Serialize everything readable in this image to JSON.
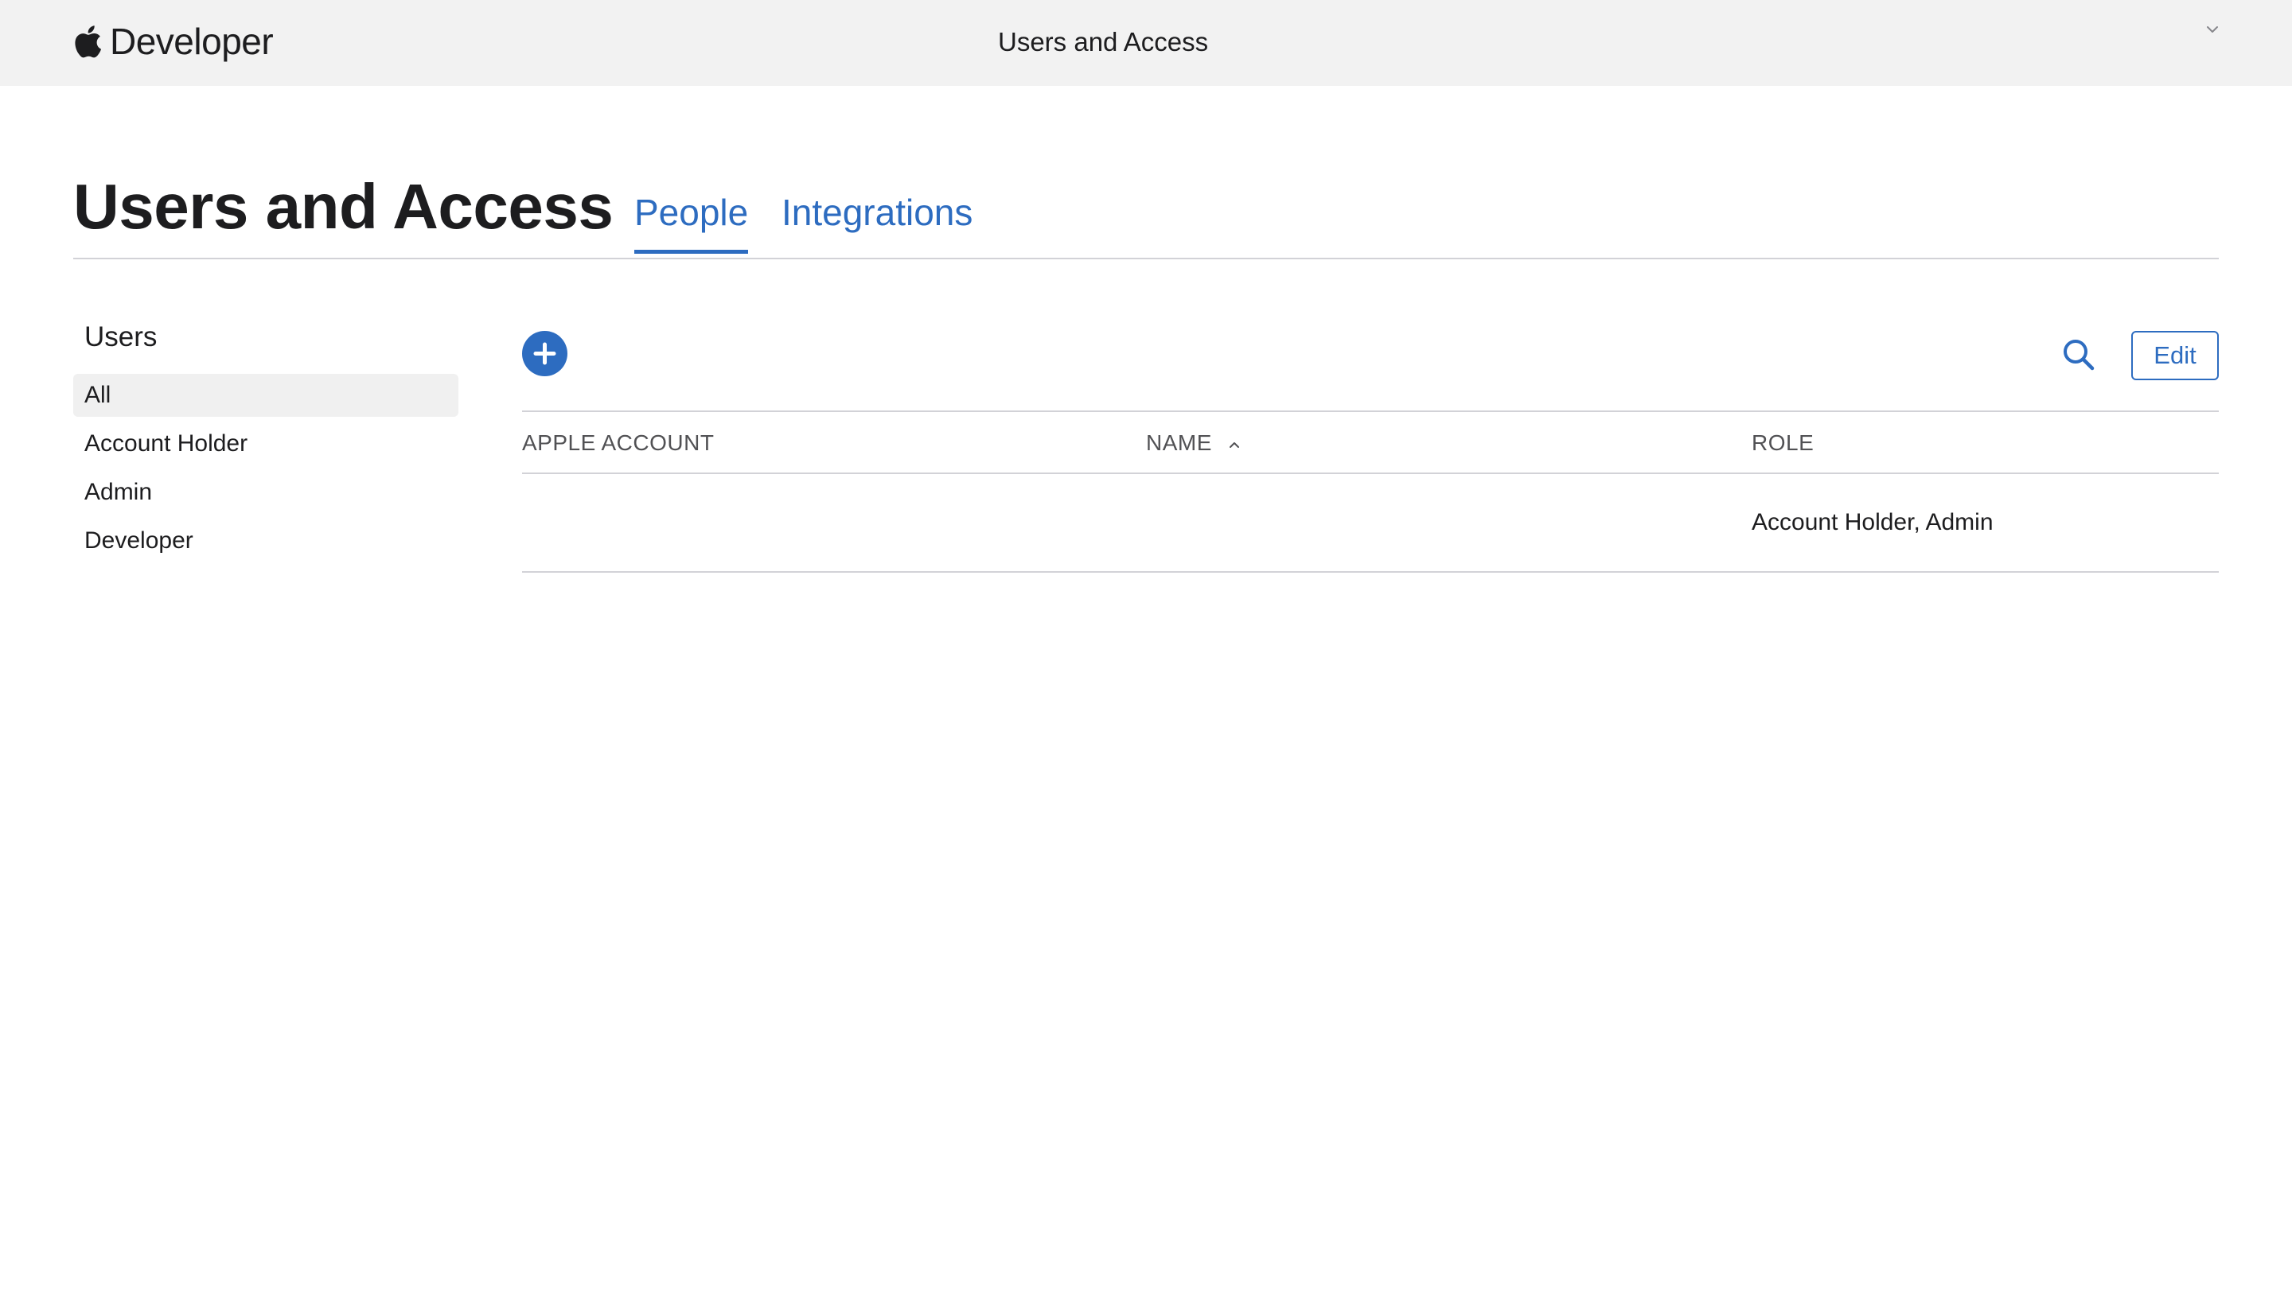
{
  "topbar": {
    "brand": "Developer",
    "title": "Users and Access",
    "brand_icon": "apple-logo-icon",
    "menu_icon": "chevron-down-icon"
  },
  "header": {
    "title": "Users and Access",
    "tabs": [
      {
        "label": "People",
        "selected": true
      },
      {
        "label": "Integrations",
        "selected": false
      }
    ]
  },
  "sidebar": {
    "heading": "Users",
    "items": [
      {
        "label": "All",
        "selected": true
      },
      {
        "label": "Account Holder",
        "selected": false
      },
      {
        "label": "Admin",
        "selected": false
      },
      {
        "label": "Developer",
        "selected": false
      }
    ]
  },
  "toolbar": {
    "add_icon": "plus-circle-icon",
    "search_icon": "search-icon",
    "edit_label": "Edit"
  },
  "table": {
    "columns": [
      "APPLE ACCOUNT",
      "NAME",
      "ROLE"
    ],
    "sort_column": "NAME",
    "sort_icon": "chevron-up-icon",
    "rows": [
      {
        "apple_account": "",
        "name": "",
        "role": "Account Holder, Admin"
      }
    ]
  },
  "colors": {
    "accent": "#2d6cc0",
    "topbar_bg": "#f2f2f2",
    "selected_bg": "#f0f0f0",
    "divider": "#d2d2d7"
  }
}
